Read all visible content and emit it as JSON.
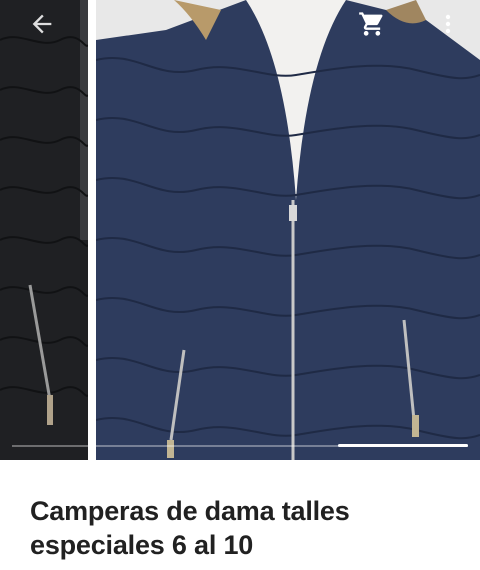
{
  "toolbar": {
    "back_icon": "arrow-left-icon",
    "cart_icon": "shopping-cart-icon",
    "more_icon": "more-vertical-icon",
    "icon_color": "#ffffff"
  },
  "gallery": {
    "current_photo": 2,
    "progress_fraction": 0.28,
    "photos": [
      {
        "subject": "black quilted jacket"
      },
      {
        "subject": "navy quilted jacket with fur hood"
      }
    ]
  },
  "product": {
    "title": "Camperas de dama talles especiales 6 al 10"
  },
  "colors": {
    "navy_jacket": "#2b3a5c",
    "black_jacket": "#1c1d20",
    "text": "#212121"
  }
}
